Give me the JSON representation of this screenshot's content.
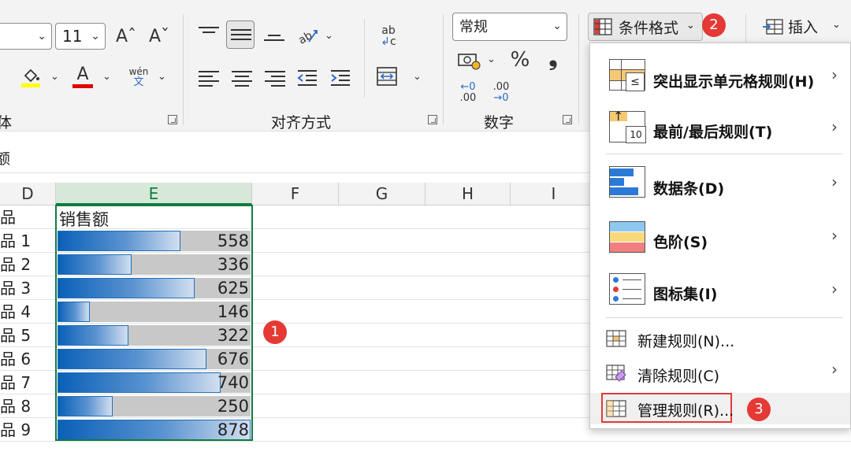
{
  "ribbon": {
    "font_size": "11",
    "font_group_label": "体",
    "alignment_group_label": "对齐方式",
    "number_group_label": "数字",
    "number_format": "常规",
    "wen_label": "wén",
    "wen_char": "文",
    "conditional_format_label": "条件格式",
    "insert_label": "插入",
    "percent_symbol": "%",
    "comma_symbol": "❟",
    "inc_decimal_top": "←0",
    "inc_decimal_bottom": ".00",
    "dec_decimal_top": ".00",
    "dec_decimal_bottom": "→0",
    "font_grow": "Aˆ",
    "font_shrink": "Aˇ",
    "font_color_letter": "A",
    "wrap_text_top": "ab",
    "wrap_text_bottom": "c",
    "colors": {
      "highlight_yellow": "#ffff00",
      "font_red": "#e00000",
      "excel_green": "#107c41",
      "badge_red": "#e53935"
    }
  },
  "formula_bar": {
    "partial_text": "额"
  },
  "grid": {
    "columns": [
      "D",
      "E",
      "F",
      "G",
      "H",
      "I"
    ],
    "header_cell": "销售额",
    "partial_row_header": "品",
    "rows": [
      {
        "label": "品 1",
        "value": "558",
        "fraction": 0.636
      },
      {
        "label": "品 2",
        "value": "336",
        "fraction": 0.383
      },
      {
        "label": "品 3",
        "value": "625",
        "fraction": 0.712
      },
      {
        "label": "品 4",
        "value": "146",
        "fraction": 0.166
      },
      {
        "label": "品 5",
        "value": "322",
        "fraction": 0.367
      },
      {
        "label": "品 6",
        "value": "676",
        "fraction": 0.77
      },
      {
        "label": "品 7",
        "value": "740",
        "fraction": 0.843
      },
      {
        "label": "品 8",
        "value": "250",
        "fraction": 0.285
      },
      {
        "label": "品 9",
        "value": "878",
        "fraction": 1.0
      }
    ]
  },
  "badges": {
    "one": "1",
    "two": "2",
    "three": "3"
  },
  "menu": {
    "items": [
      {
        "label": "突出显示单元格规则(H)",
        "has_submenu": true
      },
      {
        "label": "最前/最后规则(T)",
        "has_submenu": true,
        "icon_text": "10"
      },
      {
        "label": "数据条(D)",
        "has_submenu": true
      },
      {
        "label": "色阶(S)",
        "has_submenu": true
      },
      {
        "label": "图标集(I)",
        "has_submenu": true
      },
      {
        "label": "新建规则(N)...",
        "has_submenu": false
      },
      {
        "label": "清除规则(C)",
        "has_submenu": true
      },
      {
        "label": "管理规则(R)...",
        "has_submenu": false
      }
    ],
    "submenu_arrow": "›",
    "le_symbol": "≤",
    "up_arrow": "↑"
  }
}
